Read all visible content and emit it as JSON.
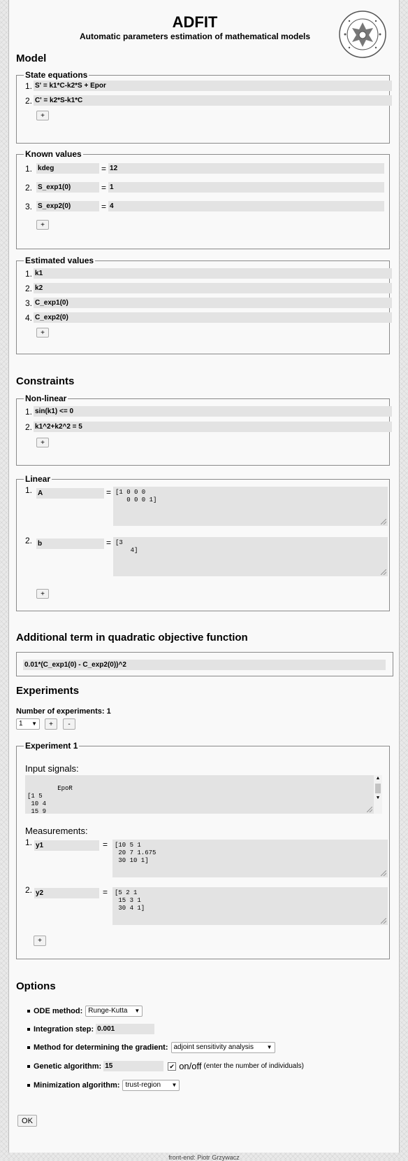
{
  "header": {
    "title": "ADFIT",
    "subtitle": "Automatic parameters estimation of mathematical models",
    "logo_text": "POLITECHNIKA ŚLĄSKA"
  },
  "model": {
    "heading": "Model",
    "state_equations": {
      "legend": "State equations",
      "items": [
        {
          "num": "1.",
          "value": "S' = k1*C-k2*S  + Epor"
        },
        {
          "num": "2.",
          "value": "C' = k2*S-k1*C"
        }
      ],
      "add_label": "+"
    },
    "known_values": {
      "legend": "Known values",
      "items": [
        {
          "num": "1.",
          "name": "kdeg",
          "eq": "=",
          "value": "12"
        },
        {
          "num": "2.",
          "name": "S_exp1(0)",
          "eq": "=",
          "value": "1"
        },
        {
          "num": "3.",
          "name": "S_exp2(0)",
          "eq": "=",
          "value": "4"
        }
      ],
      "add_label": "+"
    },
    "estimated_values": {
      "legend": "Estimated values",
      "items": [
        {
          "num": "1.",
          "value": "k1"
        },
        {
          "num": "2.",
          "value": "k2"
        },
        {
          "num": "3.",
          "value": "C_exp1(0)"
        },
        {
          "num": "4.",
          "value": "C_exp2(0)"
        }
      ],
      "add_label": "+"
    }
  },
  "constraints": {
    "heading": "Constraints",
    "nonlinear": {
      "legend": "Non-linear",
      "items": [
        {
          "num": "1.",
          "value": "sin(k1) <= 0"
        },
        {
          "num": "2.",
          "value": "k1^2+k2^2 = 5"
        }
      ],
      "add_label": "+"
    },
    "linear": {
      "legend": "Linear",
      "items": [
        {
          "num": "1.",
          "name": "A",
          "eq": "=",
          "value": "[1 0 0 0\n   0 0 0 1]"
        },
        {
          "num": "2.",
          "name": "b",
          "eq": "=",
          "value": "[3\n    4]"
        }
      ],
      "add_label": "+"
    }
  },
  "objective": {
    "heading": "Additional term in quadratic objective function",
    "value": "0.01*(C_exp1(0) - C_exp2(0))^2"
  },
  "experiments": {
    "heading": "Experiments",
    "count_label": "Number of experiments: 1",
    "count_select": "1",
    "add_label": "+",
    "remove_label": "-",
    "experiment": {
      "legend": "Experiment 1",
      "input_label": "Input signals:",
      "input_value": "EpoR\n[1 5\n 10 4\n 15 9",
      "measurements_label": "Measurements:",
      "measurements": [
        {
          "num": "1.",
          "name": "y1",
          "eq": "=",
          "value": "[10 5 1\n 20 7 1.675\n 30 10 1]"
        },
        {
          "num": "2.",
          "name": "y2",
          "eq": "=",
          "value": "[5 2 1\n 15 3 1\n 30 4 1]"
        }
      ],
      "add_label": "+"
    }
  },
  "options": {
    "heading": "Options",
    "ode_label": "ODE method:",
    "ode_value": "Runge-Kutta",
    "step_label": "Integration step:",
    "step_value": "0.001",
    "gradient_label": "Method for determining the gradient:",
    "gradient_value": "adjoint sensitivity analysis",
    "genetic_label": "Genetic algorithm:",
    "genetic_value": "15",
    "genetic_toggle_label": "on/off",
    "genetic_hint": "(enter the number of individuals)",
    "genetic_checked": true,
    "minimization_label": "Minimization algorithm:",
    "minimization_value": "trust-region"
  },
  "ok_label": "OK",
  "footer": "front-end: Piotr Grzywacz"
}
